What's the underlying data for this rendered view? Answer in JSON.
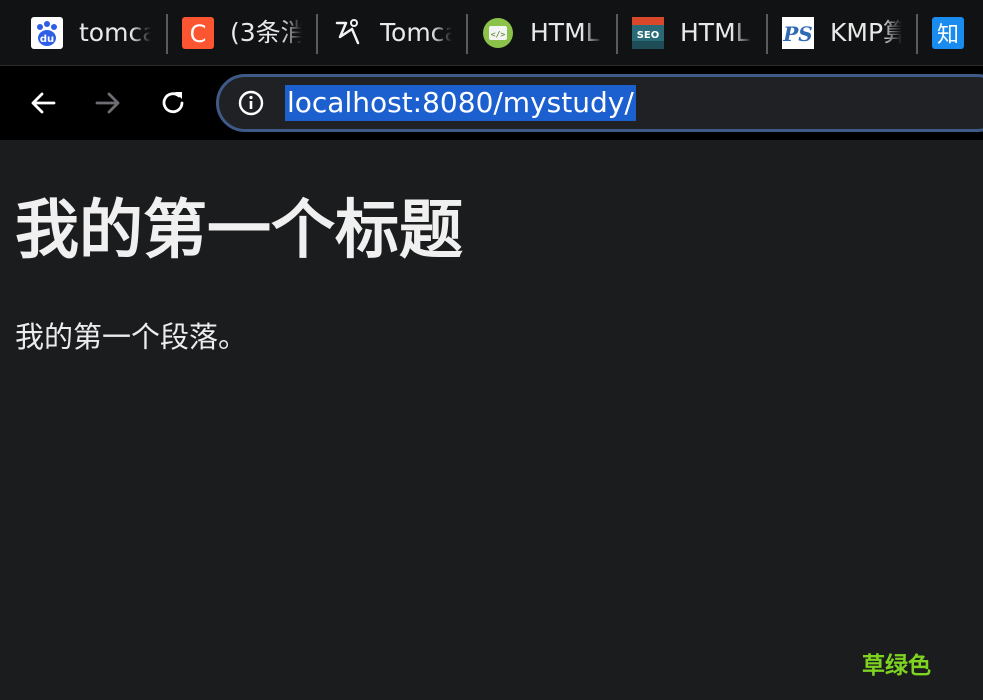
{
  "browser": {
    "tabs": [
      {
        "label": "tomca",
        "icon": "baidu-paw-icon",
        "icon_text": "du"
      },
      {
        "label": "(3条消",
        "icon": "csdn-c-icon",
        "icon_text": "C"
      },
      {
        "label": "Tomca",
        "icon": "runner-logo-icon"
      },
      {
        "label": "HTML",
        "icon": "html-code-icon"
      },
      {
        "label": "HTML",
        "icon": "seo-icon",
        "icon_text": "SEO"
      },
      {
        "label": "KMP算",
        "icon": "ps-icon",
        "icon_text": "PS"
      },
      {
        "label": "",
        "icon": "zhihu-icon",
        "icon_text": "知"
      }
    ],
    "toolbar": {
      "url": "localhost:8080/mystudy/"
    }
  },
  "page": {
    "heading": "我的第一个标题",
    "paragraph": "我的第一个段落。"
  },
  "overlay": {
    "watermark": "草绿色"
  },
  "colors": {
    "tabstrip_bg": "#111213",
    "toolbar_bg": "#000000",
    "page_bg": "#1b1c1e",
    "url_highlight": "#1c5fcf",
    "watermark": "#7ed321"
  }
}
